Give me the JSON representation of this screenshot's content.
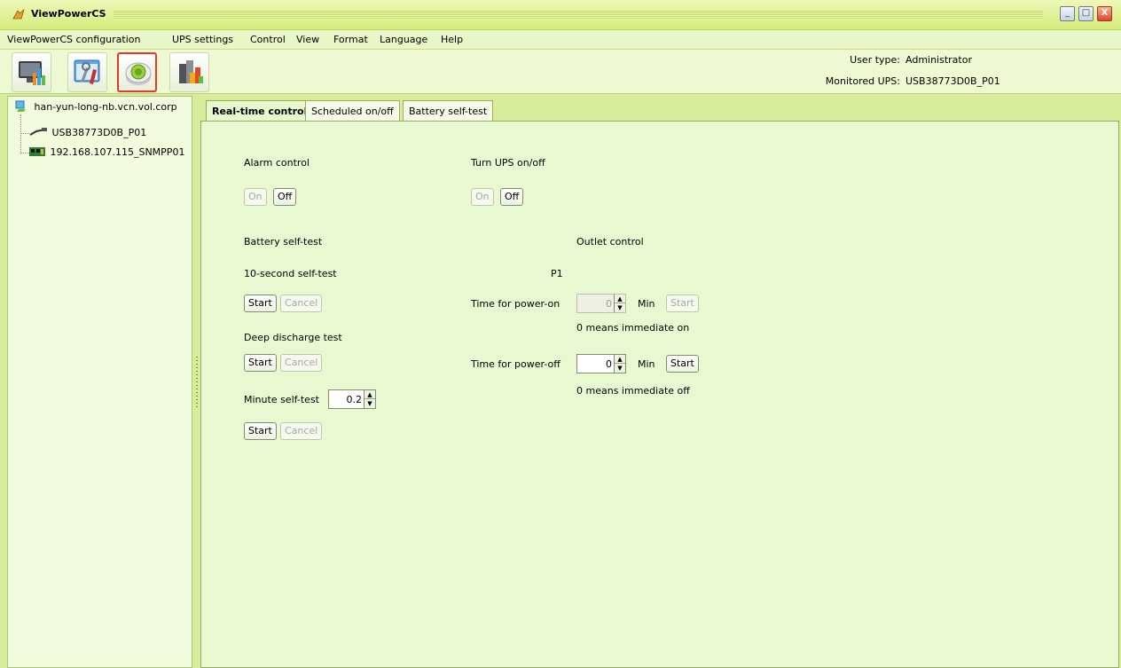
{
  "window": {
    "title": "ViewPowerCS",
    "buttons": {
      "minimize": "_",
      "maximize": "□",
      "close": "X"
    }
  },
  "menu": {
    "items": [
      "ViewPowerCS configuration",
      "UPS settings",
      "Control",
      "View",
      "Format",
      "Language",
      "Help"
    ]
  },
  "toolbar": {
    "user_type_label": "User type:",
    "user_type_value": "Administrator",
    "monitored_ups_label": "Monitored UPS:",
    "monitored_ups_value": "USB38773D0B_P01",
    "icons": [
      "monitor-chart-icon",
      "tools-icon",
      "control-button-icon",
      "data-chart-icon"
    ]
  },
  "tree": {
    "root": "han-yun-long-nb.vcn.vol.corp",
    "children": [
      "USB38773D0B_P01",
      "192.168.107.115_SNMPP01"
    ]
  },
  "tabs": [
    "Real-time control",
    "Scheduled on/off",
    "Battery self-test"
  ],
  "content": {
    "alarm": {
      "title": "Alarm control",
      "on": "On",
      "off": "Off"
    },
    "ups": {
      "title": "Turn UPS on/off",
      "on": "On",
      "off": "Off"
    },
    "battery": {
      "title": "Battery self-test",
      "ten_second": "10-second self-test",
      "deep": "Deep discharge test",
      "minute": "Minute self-test",
      "minute_value": "0.2",
      "start": "Start",
      "cancel": "Cancel"
    },
    "outlet": {
      "title": "Outlet control",
      "p1": "P1",
      "power_on_label": "Time for power-on",
      "power_on_value": "0",
      "power_on_note": "0 means immediate on",
      "power_off_label": "Time for power-off",
      "power_off_value": "0",
      "power_off_note": "0 means immediate off",
      "unit": "Min",
      "start": "Start"
    }
  }
}
